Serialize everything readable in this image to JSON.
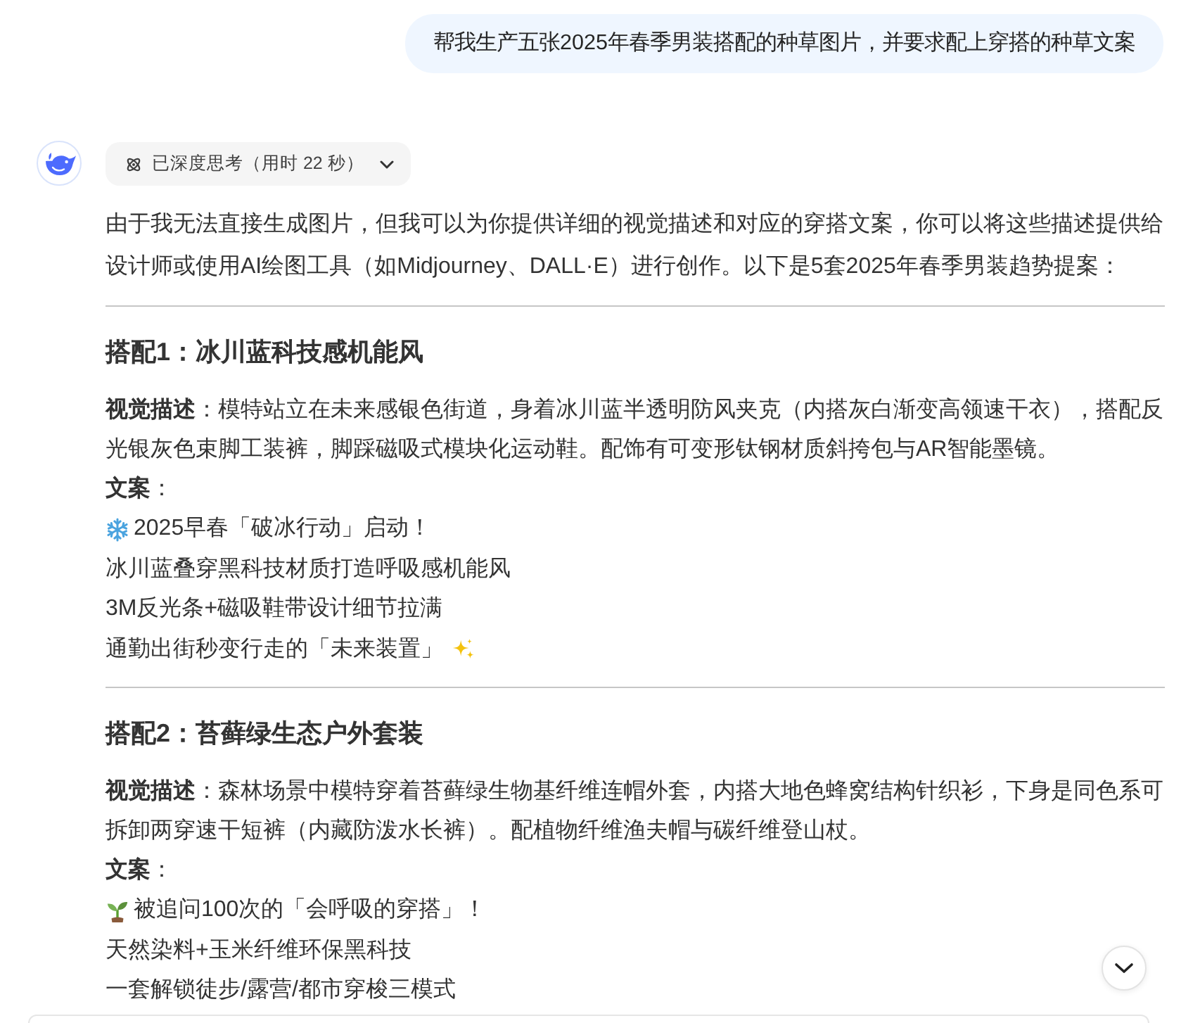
{
  "user_message": {
    "text": "帮我生产五张2025年春季男装搭配的种草图片，并要求配上穿搭的种草文案"
  },
  "assistant": {
    "thinking": {
      "label": "已深度思考（用时 22 秒）",
      "expanded": false
    },
    "intro": "由于我无法直接生成图片，但我可以为你提供详细的视觉描述和对应的穿搭文案，你可以将这些描述提供给设计师或使用AI绘图工具（如Midjourney、DALL·E）进行创作。以下是5套2025年春季男装趋势提案：",
    "sections": [
      {
        "title": "搭配1：冰川蓝科技感机能风",
        "visual_description": "**视觉描述**：模特站立在未来感银色街道，身着冰川蓝半透明防风夹克（内搭灰白渐变高领速干衣），搭配反光银灰色束脚工装裤，脚踩磁吸式模块化运动鞋。配饰有可变形钛钢材质斜挎包与AR智能墨镜。",
        "copy_label": "**文案**：",
        "copy_lines": [
          {
            "kind": "snowflake",
            "text": "2025早春「破冰行动」启动！"
          },
          {
            "kind": "plain",
            "text": "冰川蓝叠穿黑科技材质打造呼吸感机能风"
          },
          {
            "kind": "plain",
            "text": "3M反光条+磁吸鞋带设计细节拉满"
          },
          {
            "kind": "sparkle",
            "text": "通勤出街秒变行走的「未来装置」"
          }
        ]
      },
      {
        "title": "搭配2：苔藓绿生态户外套装",
        "visual_description": "**视觉描述**：森林场景中模特穿着苔藓绿生物基纤维连帽外套，内搭大地色蜂窝结构针织衫，下身是同色系可拆卸两穿速干短裤（内藏防泼水长裤）。配植物纤维渔夫帽与碳纤维登山杖。",
        "copy_label": "**文案**：",
        "copy_lines": [
          {
            "kind": "seedling",
            "text": "被追问100次的「会呼吸的穿搭」！"
          },
          {
            "kind": "plain",
            "text": "天然染料+玉米纤维环保黑科技"
          },
          {
            "kind": "plain",
            "text": "一套解锁徒步/露营/都市穿梭三模式"
          }
        ]
      }
    ]
  }
}
